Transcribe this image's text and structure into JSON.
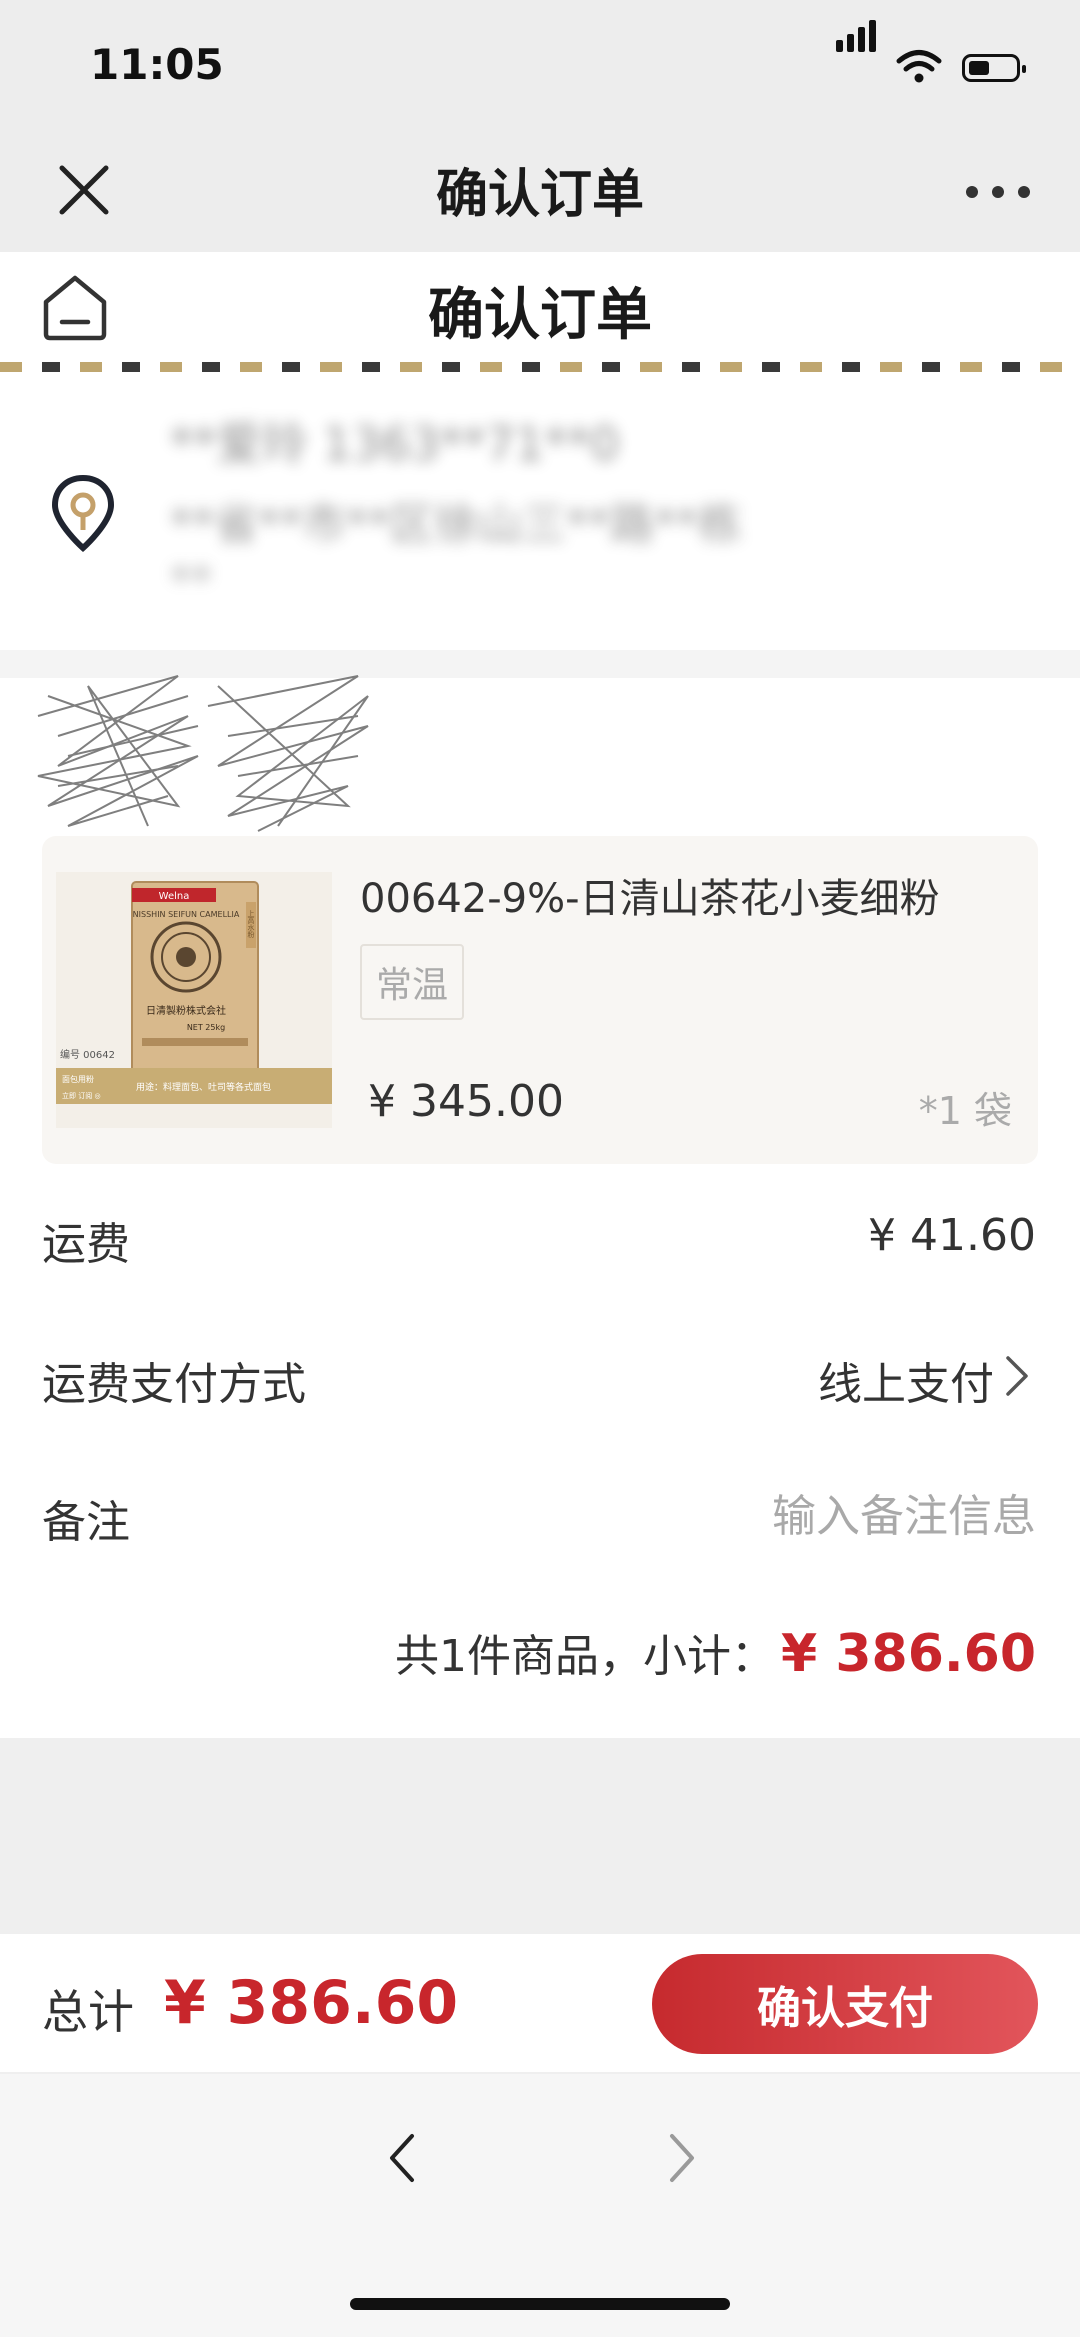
{
  "status_bar": {
    "time": "11:05"
  },
  "nav": {
    "title": "确认订单"
  },
  "page": {
    "title": "确认订单"
  },
  "address": {
    "line1": "**爱玲 1363**71**0",
    "line2": "**省**市**区徐山三**路**栋",
    "line3": "**"
  },
  "item": {
    "name": "00642-9%-日清山茶花小麦细粉",
    "tag": "常温",
    "price": "¥ 345.00",
    "qty": "*1 袋",
    "image": {
      "brand": "Welna",
      "series": "NISSHIN SEIFUN CAMELLIA",
      "center": "日清製粉株式会社",
      "net": "NET 25kg",
      "side": "上高水粉",
      "code": "编号 00642",
      "usage": "用途：料理面包、吐司等各式面包",
      "tag1": "面包用粉",
      "tag2": "立即 订阅 ◎"
    }
  },
  "fees": {
    "freight_label": "运费",
    "freight_value": "¥ 41.60",
    "payway_label": "运费支付方式",
    "payway_value": "线上支付",
    "remark_label": "备注",
    "remark_placeholder": "输入备注信息",
    "subtotal_text": "共1件商品，小计：",
    "subtotal_amount": "¥ 386.60"
  },
  "bottom": {
    "total_label": "总计",
    "total_amount": "¥ 386.60",
    "pay_button": "确认支付"
  },
  "colors": {
    "accent_red": "#c8262c",
    "stripe_gold": "#bfa66f"
  }
}
